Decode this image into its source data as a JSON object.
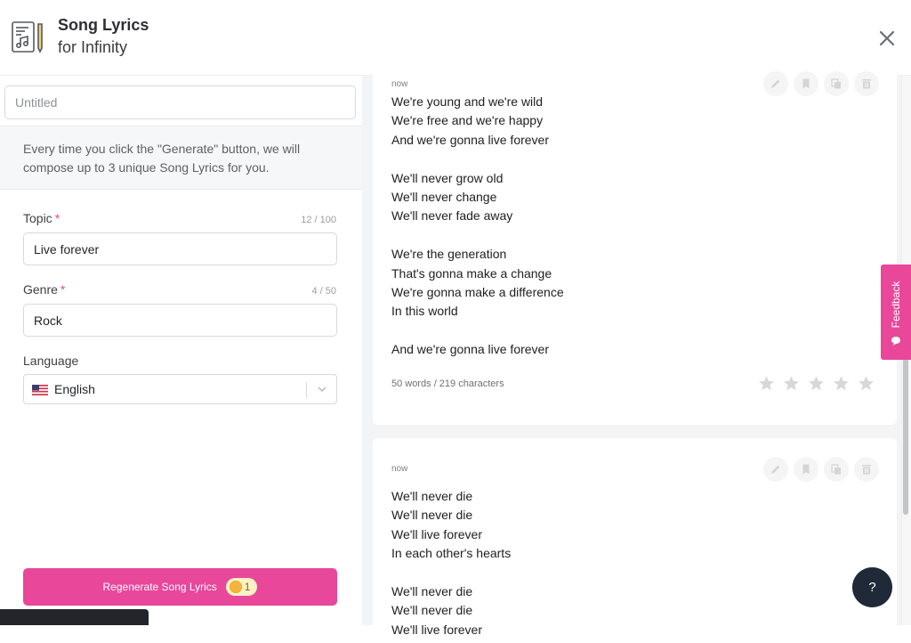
{
  "header": {
    "title": "Song Lyrics",
    "subtitle": "for Infinity",
    "logo_icon": "song-lyrics-document-icon",
    "close_icon": "close-icon"
  },
  "form": {
    "doc_title": {
      "value": "",
      "placeholder": "Untitled"
    },
    "info_text": "Every time you click the \"Generate\" button, we will compose up to 3 unique Song Lyrics for you.",
    "topic": {
      "label": "Topic",
      "required_mark": "*",
      "counter": "12 / 100",
      "value": "Live forever"
    },
    "genre": {
      "label": "Genre",
      "required_mark": "*",
      "counter": "4 / 50",
      "value": "Rock"
    },
    "language": {
      "label": "Language",
      "selected": "English",
      "flag_icon": "us-flag-icon"
    },
    "generate_button": {
      "label": "Regenerate Song Lyrics",
      "credits": "1",
      "credit_icon": "coin-icon"
    }
  },
  "results": [
    {
      "time": "now",
      "lyrics": "We're young and we're wild\nWe're free and we're happy\nAnd we're gonna live forever\n\nWe'll never grow old\nWe'll never change\nWe'll never fade away\n\nWe're the generation\nThat's gonna make a change\nWe're gonna make a difference\nIn this world\n\nAnd we're gonna live forever",
      "stats": "50 words / 219 characters",
      "rating": 0,
      "rating_max": 5
    },
    {
      "time": "now",
      "lyrics": "We'll never die\nWe'll never die\nWe'll live forever\nIn each other's hearts\n\nWe'll never die\nWe'll never die\nWe'll live forever"
    }
  ],
  "card_actions": [
    "edit",
    "bookmark",
    "copy",
    "delete"
  ],
  "feedback": {
    "label": "Feedback"
  },
  "help": {
    "label": "?"
  },
  "colors": {
    "accent": "#e8479a",
    "help_bg": "#1f2937",
    "credit_pill": "#fdf2c4"
  }
}
